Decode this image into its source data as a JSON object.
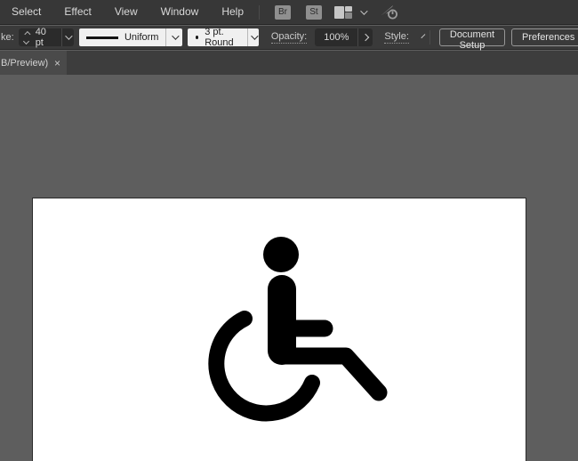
{
  "menu_bar": {
    "items": [
      "Select",
      "Effect",
      "View",
      "Window",
      "Help"
    ],
    "brushes_button": "Br",
    "strokes_button": "St"
  },
  "control_bar": {
    "stroke_label": "ke:",
    "stroke_weight_value": "40 pt",
    "width_profile_value": "Uniform",
    "brush_value": "3 pt. Round",
    "opacity_label": "Opacity:",
    "opacity_value": "100%",
    "style_label": "Style:",
    "document_setup_button": "Document Setup",
    "preferences_button": "Preferences"
  },
  "tab_bar": {
    "document_tab_label": "B/Preview)",
    "close_label": "×"
  },
  "canvas": {
    "icon_name": "wheelchair-accessibility-symbol"
  },
  "colors": {
    "bar_background": "#3a3a3a",
    "menu_background": "#373737",
    "tab_row_background": "#3d3d3d",
    "active_tab_background": "#4a4a4a",
    "field_background": "#2b2b2b",
    "white_combo_background": "#f0f0f0",
    "canvas_background": "#5e5e5e",
    "artboard_background": "#ffffff",
    "icon_color": "#000000"
  }
}
